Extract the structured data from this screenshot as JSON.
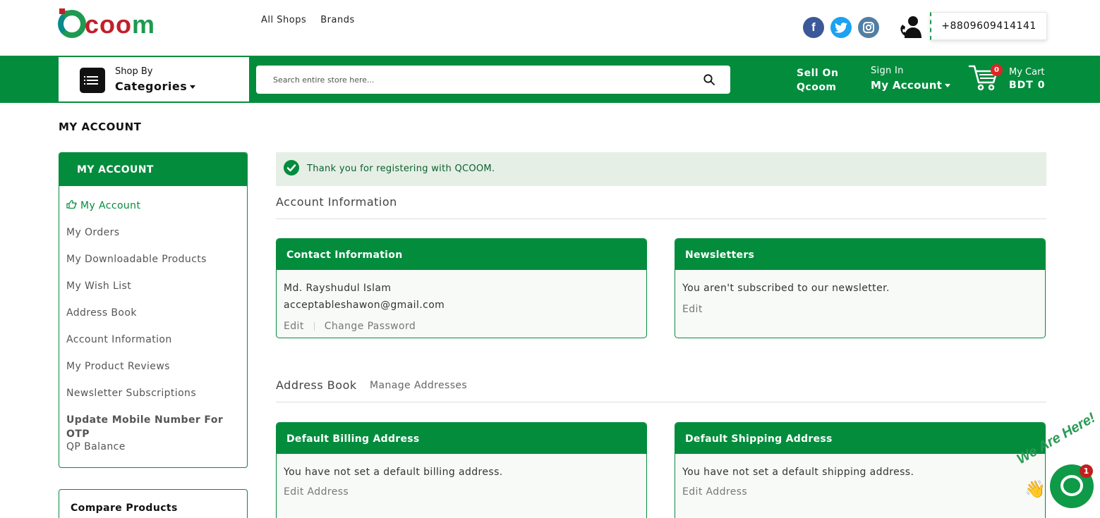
{
  "header": {
    "logo_text_c": "Q",
    "logo_text_red": "coo",
    "logo_text_green": "m",
    "nav": [
      "All Shops",
      "Brands"
    ],
    "phone": "+8809609414141"
  },
  "bar": {
    "shop_by": "Shop By",
    "categories": "Categories",
    "search_placeholder": "Search entire store here...",
    "sell_line1": "Sell On",
    "sell_line2": "Qcoom",
    "sign_in": "Sign In",
    "my_account": "My Account",
    "cart_count": "0",
    "cart_label": "My Cart",
    "cart_total": "BDT 0"
  },
  "page_title": "MY ACCOUNT",
  "sidebar": {
    "title": "MY ACCOUNT",
    "items": [
      {
        "label": "My Account"
      },
      {
        "label": "My Orders"
      },
      {
        "label": "My Downloadable Products"
      },
      {
        "label": "My Wish List"
      },
      {
        "label": "Address Book"
      },
      {
        "label": "Account Information"
      },
      {
        "label": "My Product Reviews"
      },
      {
        "label": "Newsletter Subscriptions"
      },
      {
        "label": "Update Mobile Number For OTP"
      },
      {
        "label": "QP Balance"
      }
    ],
    "compare_title": "Compare Products"
  },
  "notice": "Thank you for registering with QCOOM.",
  "account_info": {
    "title": "Account Information",
    "contact": {
      "title": "Contact Information",
      "name": "Md. Rayshudul Islam",
      "email": "acceptableshawon@gmail.com",
      "edit": "Edit",
      "change_password": "Change Password"
    },
    "newsletters": {
      "title": "Newsletters",
      "text": "You aren't subscribed to our newsletter.",
      "edit": "Edit"
    }
  },
  "address_book": {
    "title": "Address Book",
    "manage": "Manage Addresses",
    "billing": {
      "title": "Default Billing Address",
      "text": "You have not set a default billing address.",
      "edit": "Edit Address"
    },
    "shipping": {
      "title": "Default Shipping Address",
      "text": "You have not set a default shipping address.",
      "edit": "Edit Address"
    }
  },
  "chat": {
    "badge": "1",
    "tagline": "We Are Here!"
  },
  "colors": {
    "brand_green": "#048c3d",
    "brand_red": "#c0202a",
    "notice_bg": "#e5efe6"
  }
}
